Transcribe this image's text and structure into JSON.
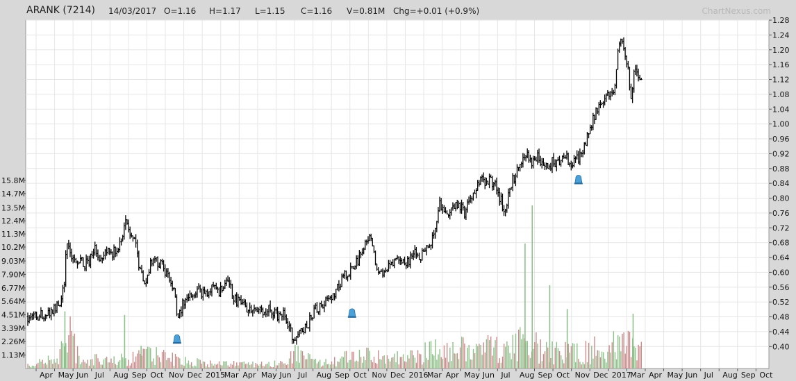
{
  "header": {
    "symbol": "ARANK (7214)",
    "date": "14/03/2017",
    "open": "O=1.16",
    "high": "H=1.17",
    "low": "L=1.15",
    "close": "C=1.16",
    "volume": "V=0.81M",
    "change": "Chg=+0.01 (+0.9%)",
    "brand": "ChartNexus.com"
  },
  "colors": {
    "background": "#d8d8d8",
    "plot": "#ffffff",
    "grid": "#e6e6e6",
    "price_bar": "#000000",
    "volume_up": "#8fbf8a",
    "volume_down": "#c98a8a",
    "signal_marker": "#4aa0d8"
  },
  "chart_data": {
    "type": "ohlc_with_volume",
    "grid": true,
    "price_axis": {
      "side": "right",
      "ylim": [
        0.38,
        1.28
      ],
      "ticks": [
        "1.28",
        "1.24",
        "1.20",
        "1.16",
        "1.12",
        "1.08",
        "1.04",
        "1.00",
        "0.96",
        "0.92",
        "0.88",
        "0.84",
        "0.80",
        "0.76",
        "0.72",
        "0.68",
        "0.64",
        "0.60",
        "0.56",
        "0.52",
        "0.48",
        "0.44",
        "0.40"
      ]
    },
    "volume_axis": {
      "side": "left",
      "ticks": [
        "15.8M",
        "14.7M",
        "13.5M",
        "12.4M",
        "11.3M",
        "10.2M",
        "9.03M",
        "7.90M",
        "6.77M",
        "5.64M",
        "4.51M",
        "3.39M",
        "2.26M",
        "1.13M"
      ],
      "max_millions": 16.9
    },
    "x_axis": {
      "labels": [
        "Apr",
        "May",
        "Jun",
        "Jul",
        "Aug",
        "Sep",
        "Oct",
        "Nov",
        "Dec",
        "2015",
        "Mar",
        "Apr",
        "May",
        "Jun",
        "Jul",
        "Aug",
        "Sep",
        "Oct",
        "Nov",
        "Dec",
        "2016",
        "Mar",
        "Apr",
        "May",
        "Jun",
        "Jul",
        "Aug",
        "Sep",
        "Oct",
        "Nov",
        "Dec",
        "2017",
        "Mar",
        "Apr",
        "May",
        "Jun",
        "Jul",
        "Aug",
        "Sep",
        "Oct"
      ]
    },
    "price_path": [
      [
        0,
        0.48
      ],
      [
        2,
        0.49
      ],
      [
        3,
        0.51
      ],
      [
        3.5,
        0.56
      ],
      [
        3.8,
        0.68
      ],
      [
        4,
        0.66
      ],
      [
        4.5,
        0.62
      ],
      [
        5,
        0.64
      ],
      [
        5.5,
        0.62
      ],
      [
        6,
        0.63
      ],
      [
        6.5,
        0.66
      ],
      [
        7,
        0.64
      ],
      [
        7.5,
        0.66
      ],
      [
        8,
        0.65
      ],
      [
        8.5,
        0.66
      ],
      [
        9,
        0.67
      ],
      [
        9.3,
        0.72
      ],
      [
        9.6,
        0.74
      ],
      [
        10,
        0.7
      ],
      [
        10.5,
        0.67
      ],
      [
        10.8,
        0.62
      ],
      [
        11,
        0.6
      ],
      [
        11.3,
        0.55
      ],
      [
        11.5,
        0.58
      ],
      [
        12,
        0.63
      ],
      [
        12.5,
        0.63
      ],
      [
        13,
        0.62
      ],
      [
        13.5,
        0.59
      ],
      [
        14,
        0.57
      ],
      [
        14.3,
        0.53
      ],
      [
        14.5,
        0.48
      ],
      [
        15,
        0.51
      ],
      [
        15.5,
        0.53
      ],
      [
        16,
        0.54
      ],
      [
        16.5,
        0.55
      ],
      [
        17,
        0.54
      ],
      [
        17.5,
        0.55
      ],
      [
        18,
        0.56
      ],
      [
        18.5,
        0.54
      ],
      [
        19,
        0.56
      ],
      [
        19.5,
        0.57
      ],
      [
        20,
        0.53
      ],
      [
        20.5,
        0.52
      ],
      [
        21,
        0.51
      ],
      [
        21.5,
        0.5
      ],
      [
        22,
        0.5
      ],
      [
        22.5,
        0.5
      ],
      [
        23,
        0.49
      ],
      [
        23.5,
        0.5
      ],
      [
        24,
        0.49
      ],
      [
        24.5,
        0.48
      ],
      [
        25,
        0.49
      ],
      [
        25.5,
        0.44
      ],
      [
        26,
        0.42
      ],
      [
        26.5,
        0.44
      ],
      [
        27,
        0.45
      ],
      [
        27.5,
        0.48
      ],
      [
        28,
        0.5
      ],
      [
        28.5,
        0.51
      ],
      [
        29,
        0.52
      ],
      [
        29.5,
        0.53
      ],
      [
        30,
        0.55
      ],
      [
        30.5,
        0.58
      ],
      [
        31,
        0.6
      ],
      [
        31.5,
        0.61
      ],
      [
        32,
        0.63
      ],
      [
        32.5,
        0.66
      ],
      [
        33,
        0.69
      ],
      [
        33.3,
        0.7
      ],
      [
        33.7,
        0.64
      ],
      [
        34,
        0.61
      ],
      [
        34.5,
        0.6
      ],
      [
        35,
        0.61
      ],
      [
        35.5,
        0.62
      ],
      [
        36,
        0.64
      ],
      [
        36.5,
        0.63
      ],
      [
        37,
        0.63
      ],
      [
        37.5,
        0.65
      ],
      [
        38,
        0.64
      ],
      [
        38.5,
        0.66
      ],
      [
        39,
        0.67
      ],
      [
        39.5,
        0.7
      ],
      [
        40,
        0.78
      ],
      [
        40.5,
        0.77
      ],
      [
        41,
        0.75
      ],
      [
        41.5,
        0.79
      ],
      [
        42,
        0.78
      ],
      [
        42.5,
        0.76
      ],
      [
        43,
        0.8
      ],
      [
        43.5,
        0.83
      ],
      [
        44,
        0.85
      ],
      [
        44.5,
        0.84
      ],
      [
        45,
        0.85
      ],
      [
        45.5,
        0.83
      ],
      [
        46,
        0.79
      ],
      [
        46.3,
        0.77
      ],
      [
        46.7,
        0.81
      ],
      [
        47,
        0.84
      ],
      [
        47.5,
        0.87
      ],
      [
        48,
        0.9
      ],
      [
        48.5,
        0.92
      ],
      [
        49,
        0.9
      ],
      [
        49.5,
        0.91
      ],
      [
        50,
        0.89
      ],
      [
        50.5,
        0.88
      ],
      [
        51,
        0.9
      ],
      [
        51.5,
        0.89
      ],
      [
        52,
        0.92
      ],
      [
        52.5,
        0.9
      ],
      [
        53,
        0.89
      ],
      [
        53.5,
        0.91
      ],
      [
        54,
        0.94
      ],
      [
        54.5,
        0.97
      ],
      [
        55,
        1.02
      ],
      [
        55.5,
        1.05
      ],
      [
        56,
        1.07
      ],
      [
        56.5,
        1.08
      ],
      [
        57,
        1.1
      ],
      [
        57.3,
        1.18
      ],
      [
        57.6,
        1.22
      ],
      [
        58,
        1.2
      ],
      [
        58.3,
        1.15
      ],
      [
        58.6,
        1.06
      ],
      [
        58.8,
        1.12
      ],
      [
        59,
        1.16
      ],
      [
        59.3,
        1.14
      ],
      [
        59.6,
        1.13
      ]
    ],
    "price_noise_amp": 0.018,
    "price_x_max": 72,
    "signal_markers": [
      {
        "price": 0.43,
        "x": 14.5
      },
      {
        "price": 0.5,
        "x": 31.5
      },
      {
        "price": 0.86,
        "x": 53.5
      }
    ],
    "volume_path": [
      [
        0,
        0.35
      ],
      [
        3,
        1.0
      ],
      [
        4,
        3.5
      ],
      [
        5,
        0.8
      ],
      [
        10,
        0.9
      ],
      [
        11,
        1.6
      ],
      [
        15,
        0.7
      ],
      [
        18,
        0.5
      ],
      [
        22,
        0.4
      ],
      [
        25,
        0.6
      ],
      [
        26,
        1.4
      ],
      [
        28,
        0.6
      ],
      [
        30,
        0.9
      ],
      [
        33,
        1.3
      ],
      [
        35,
        0.8
      ],
      [
        39,
        1.6
      ],
      [
        42,
        1.8
      ],
      [
        45,
        1.9
      ],
      [
        47,
        2.5
      ],
      [
        49,
        2.4
      ],
      [
        50,
        1.6
      ],
      [
        53,
        1.5
      ],
      [
        56,
        2.0
      ],
      [
        58,
        2.6
      ],
      [
        59.5,
        1.5
      ]
    ],
    "volume_spikes": [
      {
        "x": 3.6,
        "v": 4.8
      },
      {
        "x": 9.4,
        "v": 4.5
      },
      {
        "x": 11.0,
        "v": 1.9
      },
      {
        "x": 48.3,
        "v": 10.5
      },
      {
        "x": 49.0,
        "v": 13.7
      },
      {
        "x": 50.7,
        "v": 7.0
      },
      {
        "x": 52.4,
        "v": 5.0
      },
      {
        "x": 58.8,
        "v": 4.6
      }
    ]
  }
}
